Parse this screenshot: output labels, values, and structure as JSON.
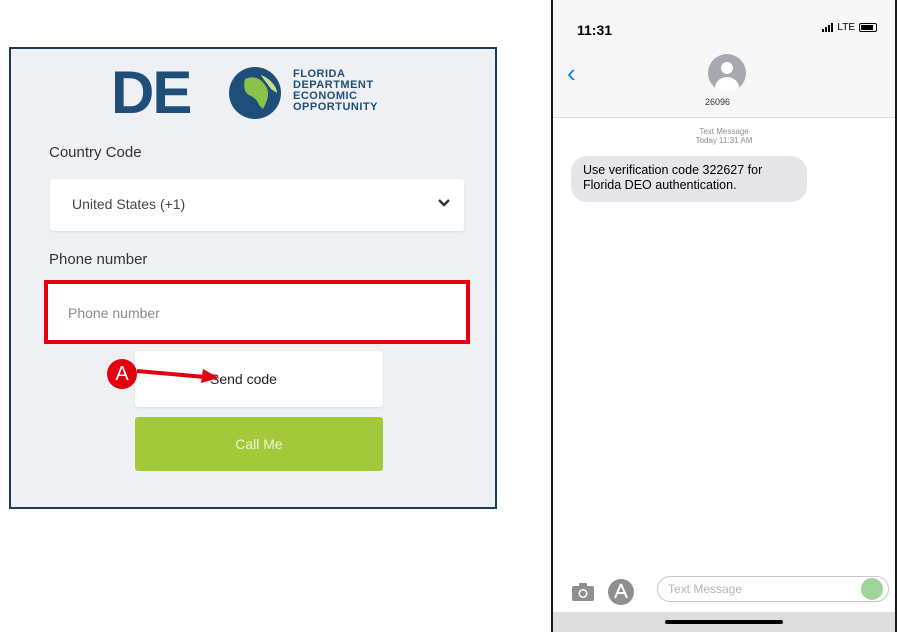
{
  "deo": {
    "logo_letters": "DE",
    "org_lines": [
      "FLORIDA",
      "DEPARTMENT",
      "ECONOMIC",
      "OPPORTUNITY"
    ],
    "country_label": "Country Code",
    "country_value": "United States (+1)",
    "phone_label": "Phone number",
    "phone_placeholder": "Phone number",
    "send_code": "Send code",
    "call_me": "Call Me",
    "marker": "A",
    "colors": {
      "brand": "#1f4e79",
      "accent": "#a1c93a",
      "highlight": "#e3000f"
    }
  },
  "phone": {
    "time": "11:31",
    "carrier": "LTE",
    "contact": "26096",
    "meta_line1": "Text Message",
    "meta_line2": "Today 11:31 AM",
    "message": "Use verification code 322627 for Florida DEO authentication.",
    "compose_placeholder": "Text Message"
  }
}
